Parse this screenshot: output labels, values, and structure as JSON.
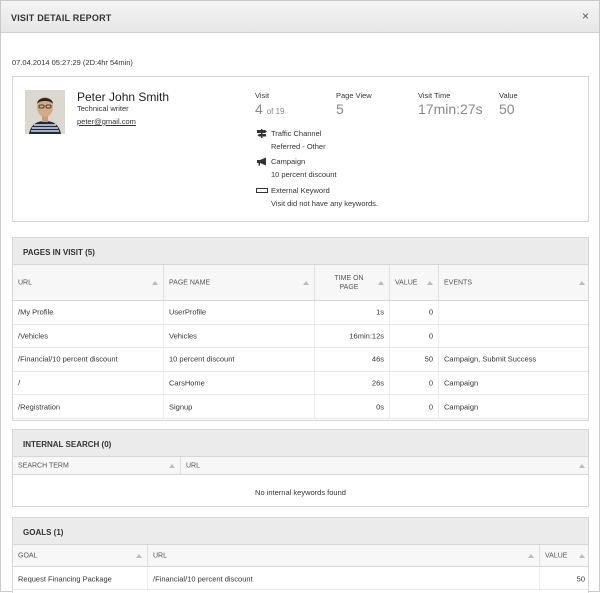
{
  "dialog": {
    "title": "VISIT DETAIL REPORT",
    "close": "×",
    "visit_date": "07.04.2014 05:27:29 (2D:4hr 54min)"
  },
  "visitor": {
    "name": "Peter John Smith",
    "job_title": "Technical writer",
    "email": "peter@gmail.com"
  },
  "stats": {
    "visit": {
      "label": "Visit",
      "value": "4",
      "of": "of 19"
    },
    "page_view": {
      "label": "Page View",
      "value": "5"
    },
    "visit_time": {
      "label": "Visit Time",
      "value": "17min:27s"
    },
    "value": {
      "label": "Value",
      "value": "50"
    }
  },
  "details": {
    "traffic_channel": {
      "label": "Traffic Channel",
      "value": "Referred - Other"
    },
    "campaign": {
      "label": "Campaign",
      "value": "10 percent discount"
    },
    "external_keyword": {
      "label": "External Keyword",
      "value": "Visit did not have any keywords."
    }
  },
  "pages_in_visit": {
    "title": "PAGES IN VISIT (5)",
    "columns": [
      "URL",
      "PAGE NAME",
      "TIME ON PAGE",
      "VALUE",
      "EVENTS"
    ],
    "rows": [
      {
        "url": "/My Profile",
        "page_name": "UserProfile",
        "time": "1s",
        "value": "0",
        "events": ""
      },
      {
        "url": "/Vehicles",
        "page_name": "Vehicles",
        "time": "16min:12s",
        "value": "0",
        "events": ""
      },
      {
        "url": "/Financial/10 percent discount",
        "page_name": "10 percent discount",
        "time": "46s",
        "value": "50",
        "events": "Campaign, Submit Success"
      },
      {
        "url": "/",
        "page_name": "CarsHome",
        "time": "26s",
        "value": "0",
        "events": "Campaign"
      },
      {
        "url": "/Registration",
        "page_name": "Signup",
        "time": "0s",
        "value": "0",
        "events": "Campaign"
      }
    ]
  },
  "internal_search": {
    "title": "INTERNAL SEARCH (0)",
    "columns": [
      "SEARCH TERM",
      "URL"
    ],
    "empty_message": "No internal keywords found"
  },
  "goals": {
    "title": "GOALS (1)",
    "columns": [
      "GOAL",
      "URL",
      "VALUE"
    ],
    "rows": [
      {
        "goal": "Request Financing Package",
        "url": "/Financial/10 percent discount",
        "value": "50"
      }
    ]
  },
  "icons": {
    "close": "close-icon",
    "traffic_channel": "signpost-icon",
    "campaign": "megaphone-icon",
    "external_keyword": "keyword-field-icon",
    "sort": "sort-arrow-icon"
  }
}
